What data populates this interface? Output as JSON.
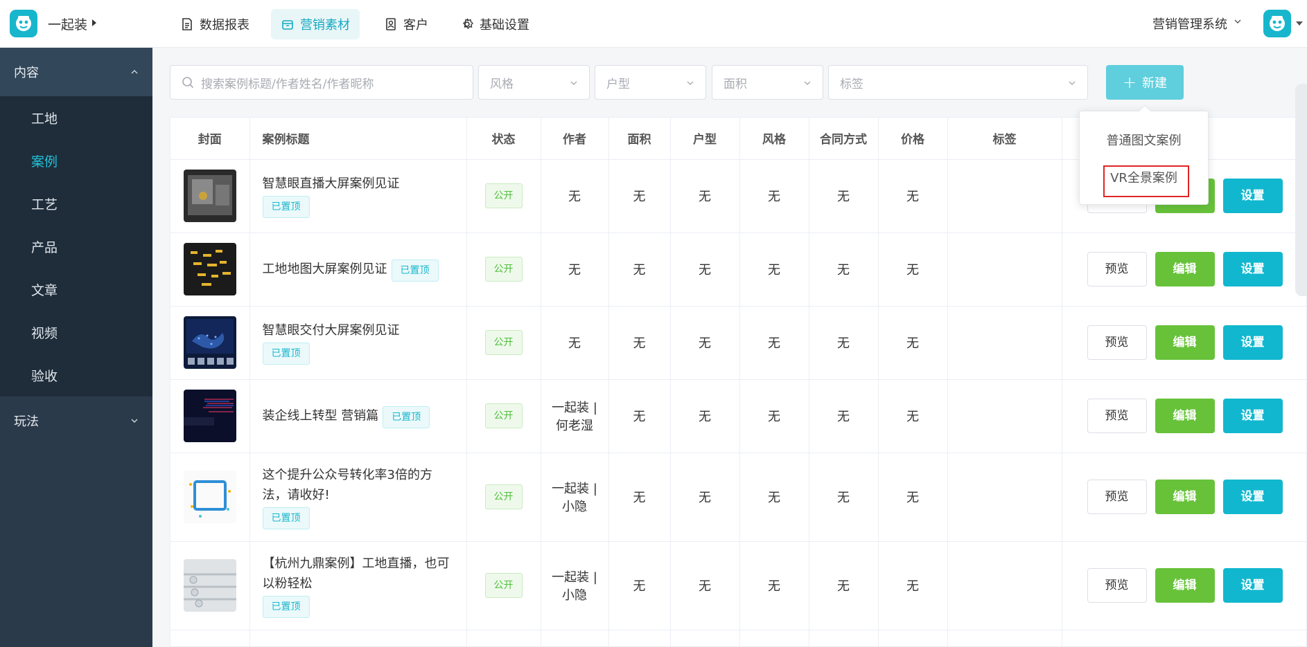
{
  "header": {
    "brand": "一起装",
    "nav": [
      {
        "label": "数据报表",
        "icon": "report-icon"
      },
      {
        "label": "营销素材",
        "icon": "box-icon",
        "active": true
      },
      {
        "label": "客户",
        "icon": "contact-icon"
      },
      {
        "label": "基础设置",
        "icon": "gear-icon"
      }
    ],
    "system": "营销管理系统"
  },
  "sidebar": {
    "groups": [
      {
        "label": "内容",
        "expanded": true,
        "items": [
          "工地",
          "案例",
          "工艺",
          "产品",
          "文章",
          "视频",
          "验收"
        ],
        "active": "案例"
      },
      {
        "label": "玩法",
        "expanded": false
      }
    ]
  },
  "filters": {
    "search_placeholder": "搜索案例标题/作者姓名/作者昵称",
    "style_placeholder": "风格",
    "house_type_placeholder": "户型",
    "area_placeholder": "面积",
    "tag_placeholder": "标签",
    "new_button": "新建"
  },
  "dropdown": {
    "items": [
      "普通图文案例",
      "VR全景案例"
    ],
    "highlighted": "VR全景案例"
  },
  "table": {
    "columns": [
      "封面",
      "案例标题",
      "状态",
      "作者",
      "面积",
      "户型",
      "风格",
      "合同方式",
      "价格",
      "标签"
    ],
    "actions": {
      "preview": "预览",
      "edit": "编辑",
      "settings": "设置"
    },
    "rows": [
      {
        "title": "智慧眼直播大屏案例见证",
        "pinned": "已置顶",
        "status": "公开",
        "author": "无",
        "area": "无",
        "house_type": "无",
        "style": "无",
        "contract": "无",
        "price": "无"
      },
      {
        "title": "工地地图大屏案例见证",
        "pinned": "已置顶",
        "status": "公开",
        "author": "无",
        "area": "无",
        "house_type": "无",
        "style": "无",
        "contract": "无",
        "price": "无"
      },
      {
        "title": "智慧眼交付大屏案例见证",
        "pinned": "已置顶",
        "status": "公开",
        "author": "无",
        "area": "无",
        "house_type": "无",
        "style": "无",
        "contract": "无",
        "price": "无"
      },
      {
        "title": "装企线上转型 营销篇",
        "pinned": "已置顶",
        "status": "公开",
        "author_line1": "一起装 |",
        "author_line2": "何老湿",
        "area": "无",
        "house_type": "无",
        "style": "无",
        "contract": "无",
        "price": "无"
      },
      {
        "title_line1": "这个提升公众号转化率3倍的方",
        "title_line2": "法，请收好!",
        "pinned": "已置顶",
        "status": "公开",
        "author_line1": "一起装 |",
        "author_line2": "小隐",
        "area": "无",
        "house_type": "无",
        "style": "无",
        "contract": "无",
        "price": "无"
      },
      {
        "title_line1": "【杭州九鼎案例】工地直播，也可",
        "title_line2": "以粉轻松",
        "pinned": "已置顶",
        "status": "公开",
        "author_line1": "一起装 |",
        "author_line2": "小隐",
        "area": "无",
        "house_type": "无",
        "style": "无",
        "contract": "无",
        "price": "无"
      }
    ]
  },
  "colors": {
    "primary": "#17b6cc",
    "sidebar_bg": "#2b3a4a",
    "edit_green": "#67c23a",
    "highlight_red": "#e02424"
  }
}
